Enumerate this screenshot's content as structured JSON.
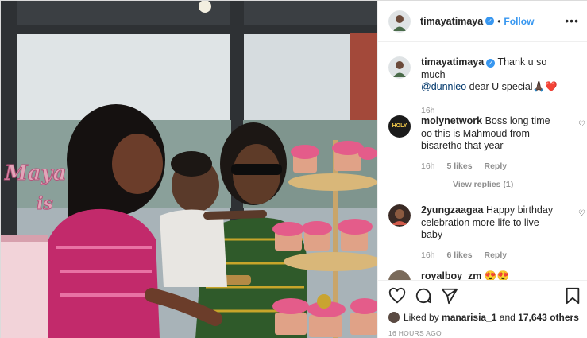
{
  "header": {
    "username": "timayatimaya",
    "dot": "•",
    "follow_label": "Follow",
    "more_icon": "more-options-icon"
  },
  "caption": {
    "username": "timayatimaya",
    "text_before": "Thank u so much",
    "mention": "@dunnieo",
    "text_after": "dear U special",
    "emoji": "🙏🏿❤️",
    "age": "16h"
  },
  "comments": [
    {
      "username": "molynetwork",
      "text": "Boss long time oo this is Mahmoud from bisaretho that year",
      "age": "16h",
      "likes": "5 likes",
      "reply_label": "Reply",
      "avatar_text": "HOLY",
      "view_replies": "View replies (1)"
    },
    {
      "username": "2yungzaagaa",
      "text": "Happy birthday celebration more life to live baby",
      "age": "16h",
      "likes": "6 likes",
      "reply_label": "Reply"
    },
    {
      "username": "royalboy_zm",
      "text": "😍😍"
    }
  ],
  "photo": {
    "sign_text_1": "Maya",
    "sign_text_2": "is"
  },
  "actions": {
    "like_icon": "heart-icon",
    "comment_icon": "comment-icon",
    "share_icon": "share-icon",
    "save_icon": "bookmark-icon",
    "liked_by_prefix": "Liked by",
    "liked_by_user": "manarisia_1",
    "liked_by_and": "and",
    "liked_by_others": "17,643 others",
    "timestamp": "16 HOURS AGO"
  },
  "colors": {
    "accent": "#3897f0",
    "text": "#262626",
    "secondary": "#8e8e8e"
  }
}
